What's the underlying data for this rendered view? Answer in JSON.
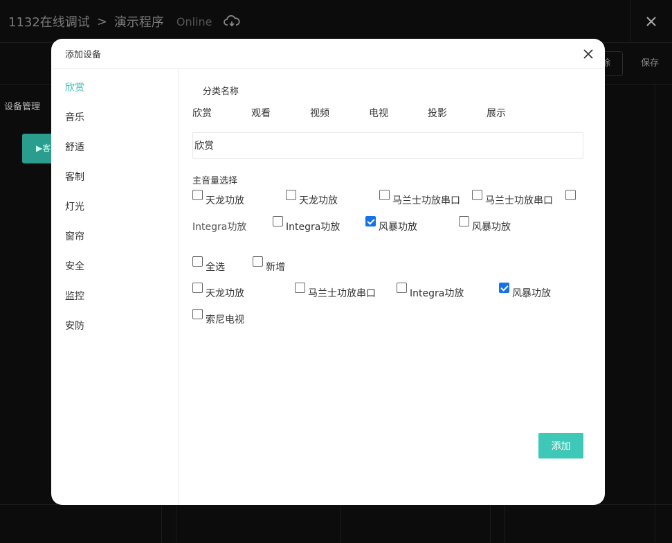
{
  "app": {
    "breadcrumb_root": "1132在线调试",
    "breadcrumb_sep": ">",
    "breadcrumb_current": "演示程序",
    "status": "Online",
    "toolbar_delete": "除",
    "toolbar_save": "保存",
    "tab_device_manage": "设备管理",
    "green_button": "▶客"
  },
  "modal": {
    "title": "添加设备",
    "sidebar": [
      "欣赏",
      "音乐",
      "舒适",
      "客制",
      "灯光",
      "窗帘",
      "安全",
      "监控",
      "安防"
    ],
    "category_label": "分类名称",
    "categories": [
      "欣赏",
      "观看",
      "视频",
      "电视",
      "投影",
      "展示"
    ],
    "name_value": "欣赏",
    "volume_label": "主音量选择",
    "volume_options": [
      {
        "label": "天龙功放",
        "checked": false
      },
      {
        "label": "天龙功放",
        "checked": false
      },
      {
        "label": "马兰士功放串口",
        "checked": false
      },
      {
        "label": "马兰士功放串口",
        "checked": false
      },
      {
        "label": "",
        "checked": false
      },
      {
        "label": "Integra功放",
        "checked": false
      },
      {
        "label": "Integra功放",
        "checked": false
      },
      {
        "label": "风暴功放",
        "checked": true
      },
      {
        "label": "风暴功放",
        "checked": false
      }
    ],
    "select_all": "全选",
    "add_new": "新增",
    "device_options": [
      {
        "label": "天龙功放",
        "checked": false
      },
      {
        "label": "马兰士功放串口",
        "checked": false
      },
      {
        "label": "Integra功放",
        "checked": false
      },
      {
        "label": "风暴功放",
        "checked": true
      },
      {
        "label": "索尼电视",
        "checked": false
      }
    ],
    "add_button": "添加"
  },
  "colors": {
    "accent": "#3cc0b4",
    "button": "#3ec8b8",
    "checkbox_checked": "#1672e6"
  }
}
